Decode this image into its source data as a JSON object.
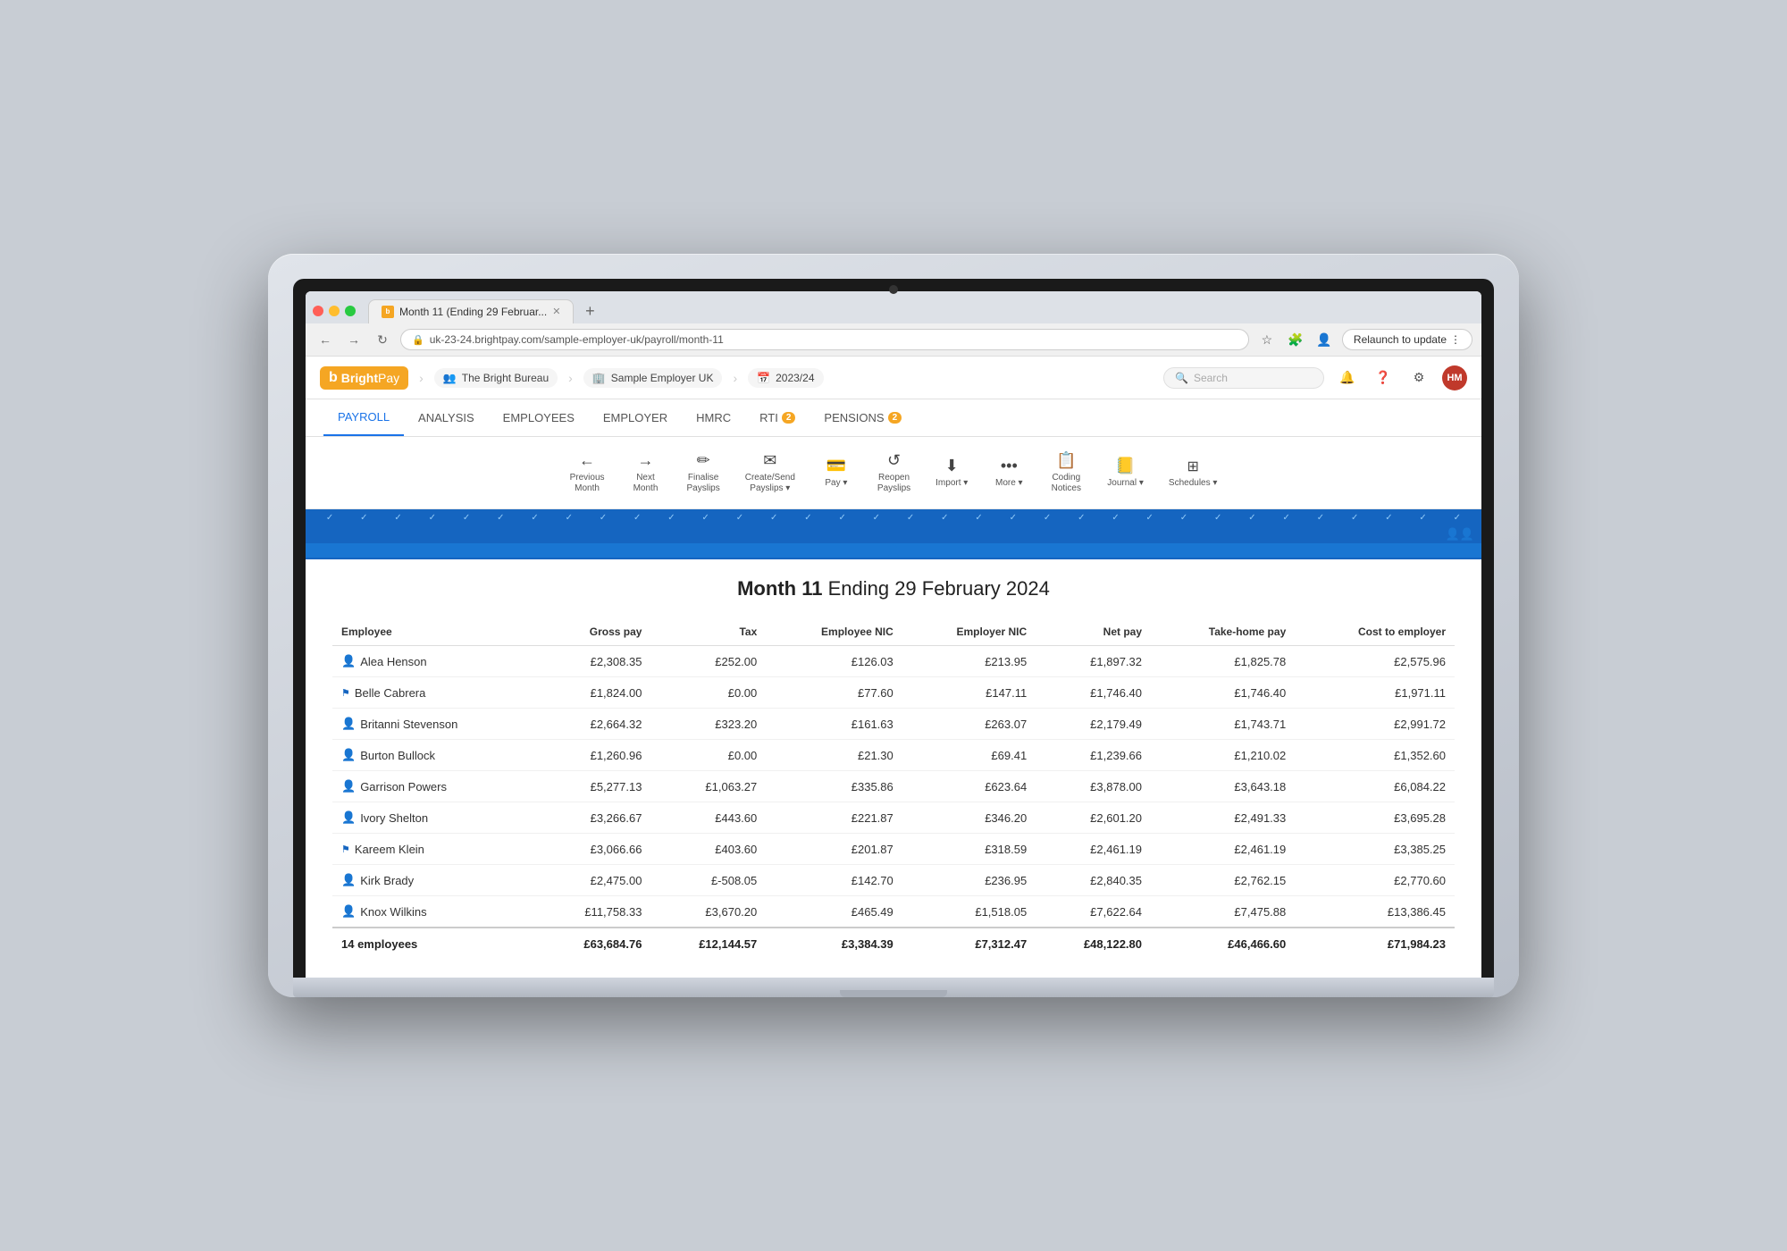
{
  "browser": {
    "tab_title": "Month 11 (Ending 29 Februar...",
    "tab_favicon_text": "b",
    "url": "uk-23-24.brightpay.com/sample-employer-uk/payroll/month-11",
    "relaunch_label": "Relaunch to update"
  },
  "app_header": {
    "logo_b": "b",
    "logo_bright": "Bright",
    "logo_pay": "Pay",
    "breadcrumb_bureau": "The Bright Bureau",
    "breadcrumb_employer": "Sample Employer UK",
    "breadcrumb_year": "2023/24",
    "search_placeholder": "Search"
  },
  "nav": {
    "tabs": [
      {
        "id": "payroll",
        "label": "PAYROLL",
        "active": true
      },
      {
        "id": "analysis",
        "label": "ANALYSIS",
        "active": false
      },
      {
        "id": "employees",
        "label": "EMPLOYEES",
        "active": false
      },
      {
        "id": "employer",
        "label": "EMPLOYER",
        "active": false
      },
      {
        "id": "hmrc",
        "label": "HMRC",
        "active": false
      },
      {
        "id": "rti",
        "label": "RTI",
        "active": false,
        "badge": "2"
      },
      {
        "id": "pensions",
        "label": "PENSIONS",
        "active": false,
        "badge": "2"
      }
    ]
  },
  "toolbar": {
    "buttons": [
      {
        "id": "prev-month",
        "icon": "←",
        "label": "Previous\nMonth"
      },
      {
        "id": "next-month",
        "icon": "→",
        "label": "Next\nMonth"
      },
      {
        "id": "finalise",
        "icon": "✎",
        "label": "Finalise\nPayslips"
      },
      {
        "id": "create-send",
        "icon": "✉",
        "label": "Create/Send\nPayslips ▾"
      },
      {
        "id": "pay",
        "icon": "💰",
        "label": "Pay ▾"
      },
      {
        "id": "reopen",
        "icon": "↺",
        "label": "Reopen\nPayslips"
      },
      {
        "id": "import",
        "icon": "⬇",
        "label": "Import ▾"
      },
      {
        "id": "more",
        "icon": "•••",
        "label": "More ▾"
      },
      {
        "id": "coding-notices",
        "icon": "📋",
        "label": "Coding\nNotices"
      },
      {
        "id": "journal",
        "icon": "📓",
        "label": "Journal ▾"
      },
      {
        "id": "schedules",
        "icon": "⋮⋮⋮",
        "label": "Schedules ▾"
      }
    ]
  },
  "payroll_heading": {
    "month_label": "Month 11",
    "period_label": "Ending 29 February 2024"
  },
  "table": {
    "columns": [
      {
        "id": "employee",
        "label": "Employee"
      },
      {
        "id": "gross_pay",
        "label": "Gross pay"
      },
      {
        "id": "tax",
        "label": "Tax"
      },
      {
        "id": "employee_nic",
        "label": "Employee NIC"
      },
      {
        "id": "employer_nic",
        "label": "Employer NIC"
      },
      {
        "id": "net_pay",
        "label": "Net pay"
      },
      {
        "id": "take_home_pay",
        "label": "Take-home pay"
      },
      {
        "id": "cost_to_employer",
        "label": "Cost to employer"
      }
    ],
    "rows": [
      {
        "name": "Alea Henson",
        "icon": "person",
        "gross_pay": "£2,308.35",
        "tax": "£252.00",
        "employee_nic": "£126.03",
        "employer_nic": "£213.95",
        "net_pay": "£1,897.32",
        "take_home_pay": "£1,825.78",
        "cost_to_employer": "£2,575.96"
      },
      {
        "name": "Belle Cabrera",
        "icon": "flag",
        "gross_pay": "£1,824.00",
        "tax": "£0.00",
        "employee_nic": "£77.60",
        "employer_nic": "£147.11",
        "net_pay": "£1,746.40",
        "take_home_pay": "£1,746.40",
        "cost_to_employer": "£1,971.11"
      },
      {
        "name": "Britanni Stevenson",
        "icon": "person",
        "gross_pay": "£2,664.32",
        "tax": "£323.20",
        "employee_nic": "£161.63",
        "employer_nic": "£263.07",
        "net_pay": "£2,179.49",
        "take_home_pay": "£1,743.71",
        "cost_to_employer": "£2,991.72"
      },
      {
        "name": "Burton Bullock",
        "icon": "person",
        "gross_pay": "£1,260.96",
        "tax": "£0.00",
        "employee_nic": "£21.30",
        "employer_nic": "£69.41",
        "net_pay": "£1,239.66",
        "take_home_pay": "£1,210.02",
        "cost_to_employer": "£1,352.60"
      },
      {
        "name": "Garrison Powers",
        "icon": "person",
        "gross_pay": "£5,277.13",
        "tax": "£1,063.27",
        "employee_nic": "£335.86",
        "employer_nic": "£623.64",
        "net_pay": "£3,878.00",
        "take_home_pay": "£3,643.18",
        "cost_to_employer": "£6,084.22"
      },
      {
        "name": "Ivory Shelton",
        "icon": "person",
        "gross_pay": "£3,266.67",
        "tax": "£443.60",
        "employee_nic": "£221.87",
        "employer_nic": "£346.20",
        "net_pay": "£2,601.20",
        "take_home_pay": "£2,491.33",
        "cost_to_employer": "£3,695.28"
      },
      {
        "name": "Kareem Klein",
        "icon": "flag",
        "gross_pay": "£3,066.66",
        "tax": "£403.60",
        "employee_nic": "£201.87",
        "employer_nic": "£318.59",
        "net_pay": "£2,461.19",
        "take_home_pay": "£2,461.19",
        "cost_to_employer": "£3,385.25"
      },
      {
        "name": "Kirk Brady",
        "icon": "person",
        "gross_pay": "£2,475.00",
        "tax": "£-508.05",
        "employee_nic": "£142.70",
        "employer_nic": "£236.95",
        "net_pay": "£2,840.35",
        "take_home_pay": "£2,762.15",
        "cost_to_employer": "£2,770.60"
      },
      {
        "name": "Knox Wilkins",
        "icon": "person",
        "gross_pay": "£11,758.33",
        "tax": "£3,670.20",
        "employee_nic": "£465.49",
        "employer_nic": "£1,518.05",
        "net_pay": "£7,622.64",
        "take_home_pay": "£7,475.88",
        "cost_to_employer": "£13,386.45"
      }
    ],
    "footer": {
      "label": "14 employees",
      "gross_pay": "£63,684.76",
      "tax": "£12,144.57",
      "employee_nic": "£3,384.39",
      "employer_nic": "£7,312.47",
      "net_pay": "£48,122.80",
      "take_home_pay": "£46,466.60",
      "cost_to_employer": "£71,984.23"
    }
  },
  "timeline": {
    "tick_count": 30,
    "person_positions": [
      28,
      29
    ]
  }
}
